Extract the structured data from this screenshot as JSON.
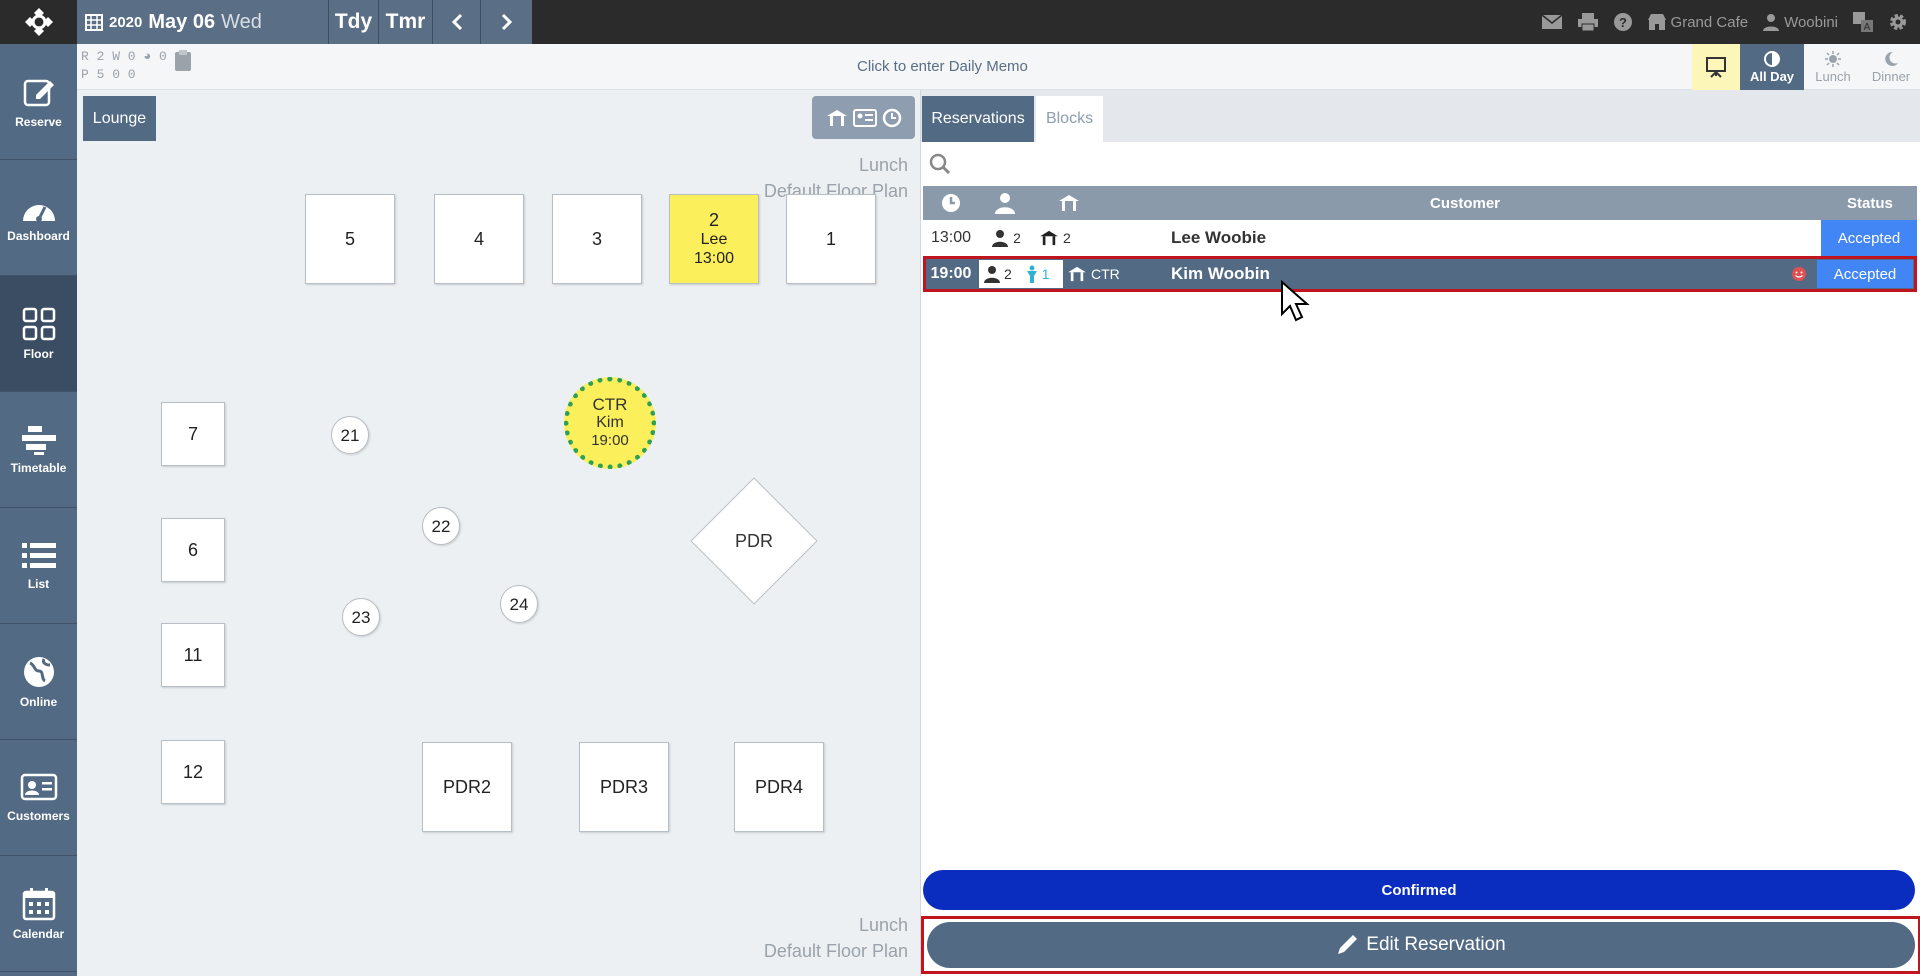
{
  "topbar": {
    "year": "2020",
    "month_day": "May 06",
    "weekday": "Wed",
    "today_label": "Tdy",
    "tomorrow_label": "Tmr",
    "restaurant": "Grand Cafe",
    "user": "Woobini"
  },
  "sidebar": {
    "items": [
      {
        "label": "Reserve",
        "icon": "edit-icon"
      },
      {
        "label": "Dashboard",
        "icon": "dashboard-icon"
      },
      {
        "label": "Floor",
        "icon": "floor-icon"
      },
      {
        "label": "Timetable",
        "icon": "timetable-icon"
      },
      {
        "label": "List",
        "icon": "list-icon"
      },
      {
        "label": "Online",
        "icon": "globe-icon"
      },
      {
        "label": "Customers",
        "icon": "customer-card-icon"
      },
      {
        "label": "Calendar",
        "icon": "calendar-icon"
      }
    ],
    "active": "Floor"
  },
  "subbar": {
    "counts_line1": "R 2 W 0 ◕ 0",
    "counts_line2": "P 5   0   0",
    "memo": "Click to enter Daily Memo",
    "shifts": [
      {
        "label": "All Day",
        "icon": "half-circle-icon"
      },
      {
        "label": "Lunch",
        "icon": "sun-icon"
      },
      {
        "label": "Dinner",
        "icon": "moon-icon"
      }
    ],
    "active_shift": "All Day"
  },
  "floor": {
    "room_tab": "Lounge",
    "plan_top_line1": "Lunch",
    "plan_top_line2": "Default Floor Plan",
    "plan_bottom_line1": "Lunch",
    "plan_bottom_line2": "Default Floor Plan",
    "tables": {
      "t5": "5",
      "t4": "4",
      "t3": "3",
      "t1": "1",
      "t2_name": "2",
      "t2_guest": "Lee",
      "t2_time": "13:00",
      "t7": "7",
      "t6": "6",
      "t11": "11",
      "t12": "12",
      "t21": "21",
      "t22": "22",
      "t23": "23",
      "t24": "24",
      "pdr": "PDR",
      "pdr2": "PDR2",
      "pdr3": "PDR3",
      "pdr4": "PDR4",
      "ctr_name": "CTR",
      "ctr_guest": "Kim",
      "ctr_time": "19:00"
    }
  },
  "reservations": {
    "tabs": [
      "Reservations",
      "Blocks"
    ],
    "columns": {
      "customer": "Customer",
      "status": "Status"
    },
    "rows": [
      {
        "time": "13:00",
        "guests": "2",
        "kids": "",
        "table": "2",
        "customer": "Lee Woobie",
        "status": "Accepted"
      },
      {
        "time": "19:00",
        "guests": "2",
        "kids": "1",
        "table": "CTR",
        "customer": "Kim Woobin",
        "status": "Accepted"
      }
    ],
    "confirmed_label": "Confirmed",
    "edit_label": "Edit Reservation"
  },
  "colors": {
    "sidebar": "#536a84",
    "accepted": "#4285f4",
    "confirmed": "#0a2dc0",
    "occupied_table": "#fbef5b",
    "highlight_border": "#c0141e"
  }
}
